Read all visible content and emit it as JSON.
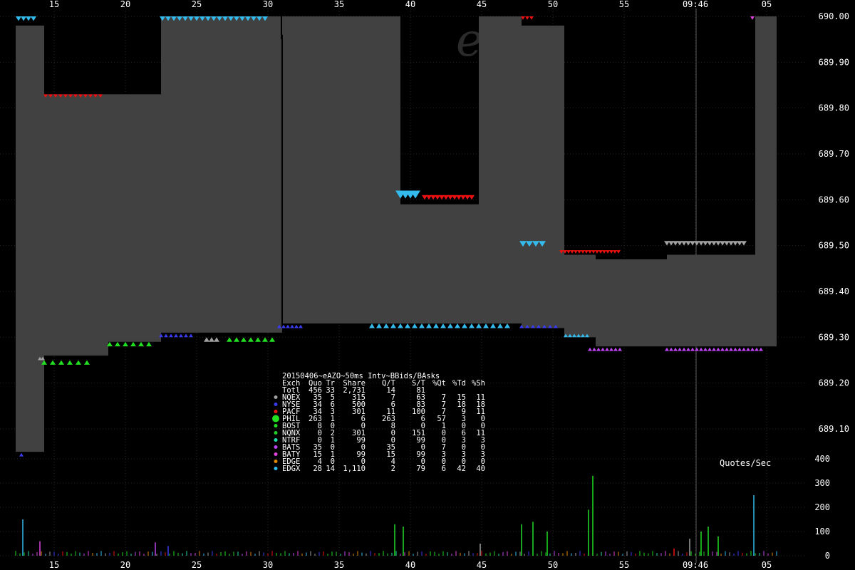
{
  "chart_data": {
    "type": "area",
    "title": "20150406~eAZO~50ms Intv~BBids/BAsks",
    "watermark": "e x",
    "x_ticks": [
      "15",
      "20",
      "25",
      "30",
      "35",
      "40",
      "45",
      "50",
      "55",
      "09:46",
      "05"
    ],
    "y_ticks": [
      "690.00",
      "689.90",
      "689.80",
      "689.70",
      "689.60",
      "689.50",
      "689.40",
      "689.30",
      "689.20",
      "689.10"
    ],
    "ylim": [
      689.04,
      690.02
    ],
    "volume_label": "Quotes/Sec",
    "volume_ticks": [
      "400",
      "300",
      "200",
      "100",
      "0"
    ],
    "volume_ylim": [
      0,
      400
    ],
    "spread_band": [
      {
        "x0": 12.3,
        "x1": 14.3,
        "bid": 689.05,
        "ask": 689.98
      },
      {
        "x0": 14.3,
        "x1": 18.8,
        "bid": 689.26,
        "ask": 689.83
      },
      {
        "x0": 18.8,
        "x1": 22.5,
        "bid": 689.29,
        "ask": 689.83
      },
      {
        "x0": 22.5,
        "x1": 30.9,
        "bid": 689.31,
        "ask": 690.0
      },
      {
        "x0": 30.9,
        "x1": 31.0,
        "bid": 689.31,
        "ask": 689.95
      },
      {
        "x0": 31.0,
        "x1": 39.3,
        "bid": 689.33,
        "ask": 690.0
      },
      {
        "x0": 39.3,
        "x1": 44.8,
        "bid": 689.33,
        "ask": 689.59
      },
      {
        "x0": 44.8,
        "x1": 47.8,
        "bid": 689.33,
        "ask": 690.0
      },
      {
        "x0": 47.8,
        "x1": 50.8,
        "bid": 689.32,
        "ask": 689.98
      },
      {
        "x0": 50.8,
        "x1": 53.0,
        "bid": 689.3,
        "ask": 689.48
      },
      {
        "x0": 53.0,
        "x1": 58.0,
        "bid": 689.28,
        "ask": 689.47
      },
      {
        "x0": 58.0,
        "x1": 64.2,
        "bid": 689.28,
        "ask": 689.48
      },
      {
        "x0": 64.2,
        "x1": 65.7,
        "bid": 689.28,
        "ask": 690.0
      }
    ],
    "exchange_colors": {
      "NQEX": "#a0a0a0",
      "NYSE": "#3a3aee",
      "PACF": "#ee1111",
      "PHIL": "#22dd22",
      "BOST": "#22dd22",
      "NQNX": "#22cc22",
      "NTRF": "#22ddaa",
      "BATS": "#bb44ee",
      "BATY": "#dd44dd",
      "EDGE": "#dd8800",
      "EDGX": "#33bbee"
    },
    "table": {
      "headers": [
        "Exch",
        "Quo",
        "Tr",
        "Share",
        "Q/T",
        "S/T",
        "%Qt",
        "%Td",
        "%Sh"
      ],
      "rows": [
        [
          "Totl",
          "456",
          "33",
          "2,731",
          "14",
          "81",
          "",
          "",
          ""
        ],
        [
          "NQEX",
          "35",
          "5",
          "315",
          "7",
          "63",
          "7",
          "15",
          "11"
        ],
        [
          "NYSE",
          "34",
          "6",
          "500",
          "6",
          "83",
          "7",
          "18",
          "18"
        ],
        [
          "PACF",
          "34",
          "3",
          "301",
          "11",
          "100",
          "7",
          "9",
          "11"
        ],
        [
          "PHIL",
          "263",
          "1",
          "6",
          "263",
          "6",
          "57",
          "3",
          "0"
        ],
        [
          "BOST",
          "8",
          "0",
          "0",
          "8",
          "0",
          "1",
          "0",
          "0"
        ],
        [
          "NQNX",
          "0",
          "2",
          "301",
          "0",
          "151",
          "0",
          "6",
          "11"
        ],
        [
          "NTRF",
          "0",
          "1",
          "99",
          "0",
          "99",
          "0",
          "3",
          "3"
        ],
        [
          "BATS",
          "35",
          "0",
          "0",
          "35",
          "0",
          "7",
          "0",
          "0"
        ],
        [
          "BATY",
          "15",
          "1",
          "99",
          "15",
          "99",
          "3",
          "3",
          "3"
        ],
        [
          "EDGE",
          "4",
          "0",
          "0",
          "4",
          "0",
          "0",
          "0",
          "0"
        ],
        [
          "EDGX",
          "28",
          "14",
          "1,110",
          "2",
          "79",
          "6",
          "42",
          "40"
        ]
      ]
    },
    "volume_spikes": [
      {
        "x": 12.8,
        "v": 150,
        "exch": "EDGX"
      },
      {
        "x": 14.0,
        "v": 60,
        "exch": "BATY"
      },
      {
        "x": 22.1,
        "v": 55,
        "exch": "BATS"
      },
      {
        "x": 23.0,
        "v": 40,
        "exch": "NYSE"
      },
      {
        "x": 38.9,
        "v": 130,
        "exch": "PHIL"
      },
      {
        "x": 39.5,
        "v": 120,
        "exch": "PHIL"
      },
      {
        "x": 44.9,
        "v": 50,
        "exch": "NQEX"
      },
      {
        "x": 47.8,
        "v": 130,
        "exch": "PHIL"
      },
      {
        "x": 48.6,
        "v": 140,
        "exch": "PHIL"
      },
      {
        "x": 49.6,
        "v": 100,
        "exch": "PHIL"
      },
      {
        "x": 52.5,
        "v": 190,
        "exch": "PHIL"
      },
      {
        "x": 52.8,
        "v": 330,
        "exch": "PHIL"
      },
      {
        "x": 58.5,
        "v": 30,
        "exch": "PACF"
      },
      {
        "x": 59.6,
        "v": 70,
        "exch": "NQEX"
      },
      {
        "x": 60.4,
        "v": 100,
        "exch": "PHIL"
      },
      {
        "x": 60.9,
        "v": 120,
        "exch": "PHIL"
      },
      {
        "x": 61.6,
        "v": 80,
        "exch": "PHIL"
      },
      {
        "x": 64.1,
        "v": 250,
        "exch": "EDGX"
      }
    ]
  }
}
